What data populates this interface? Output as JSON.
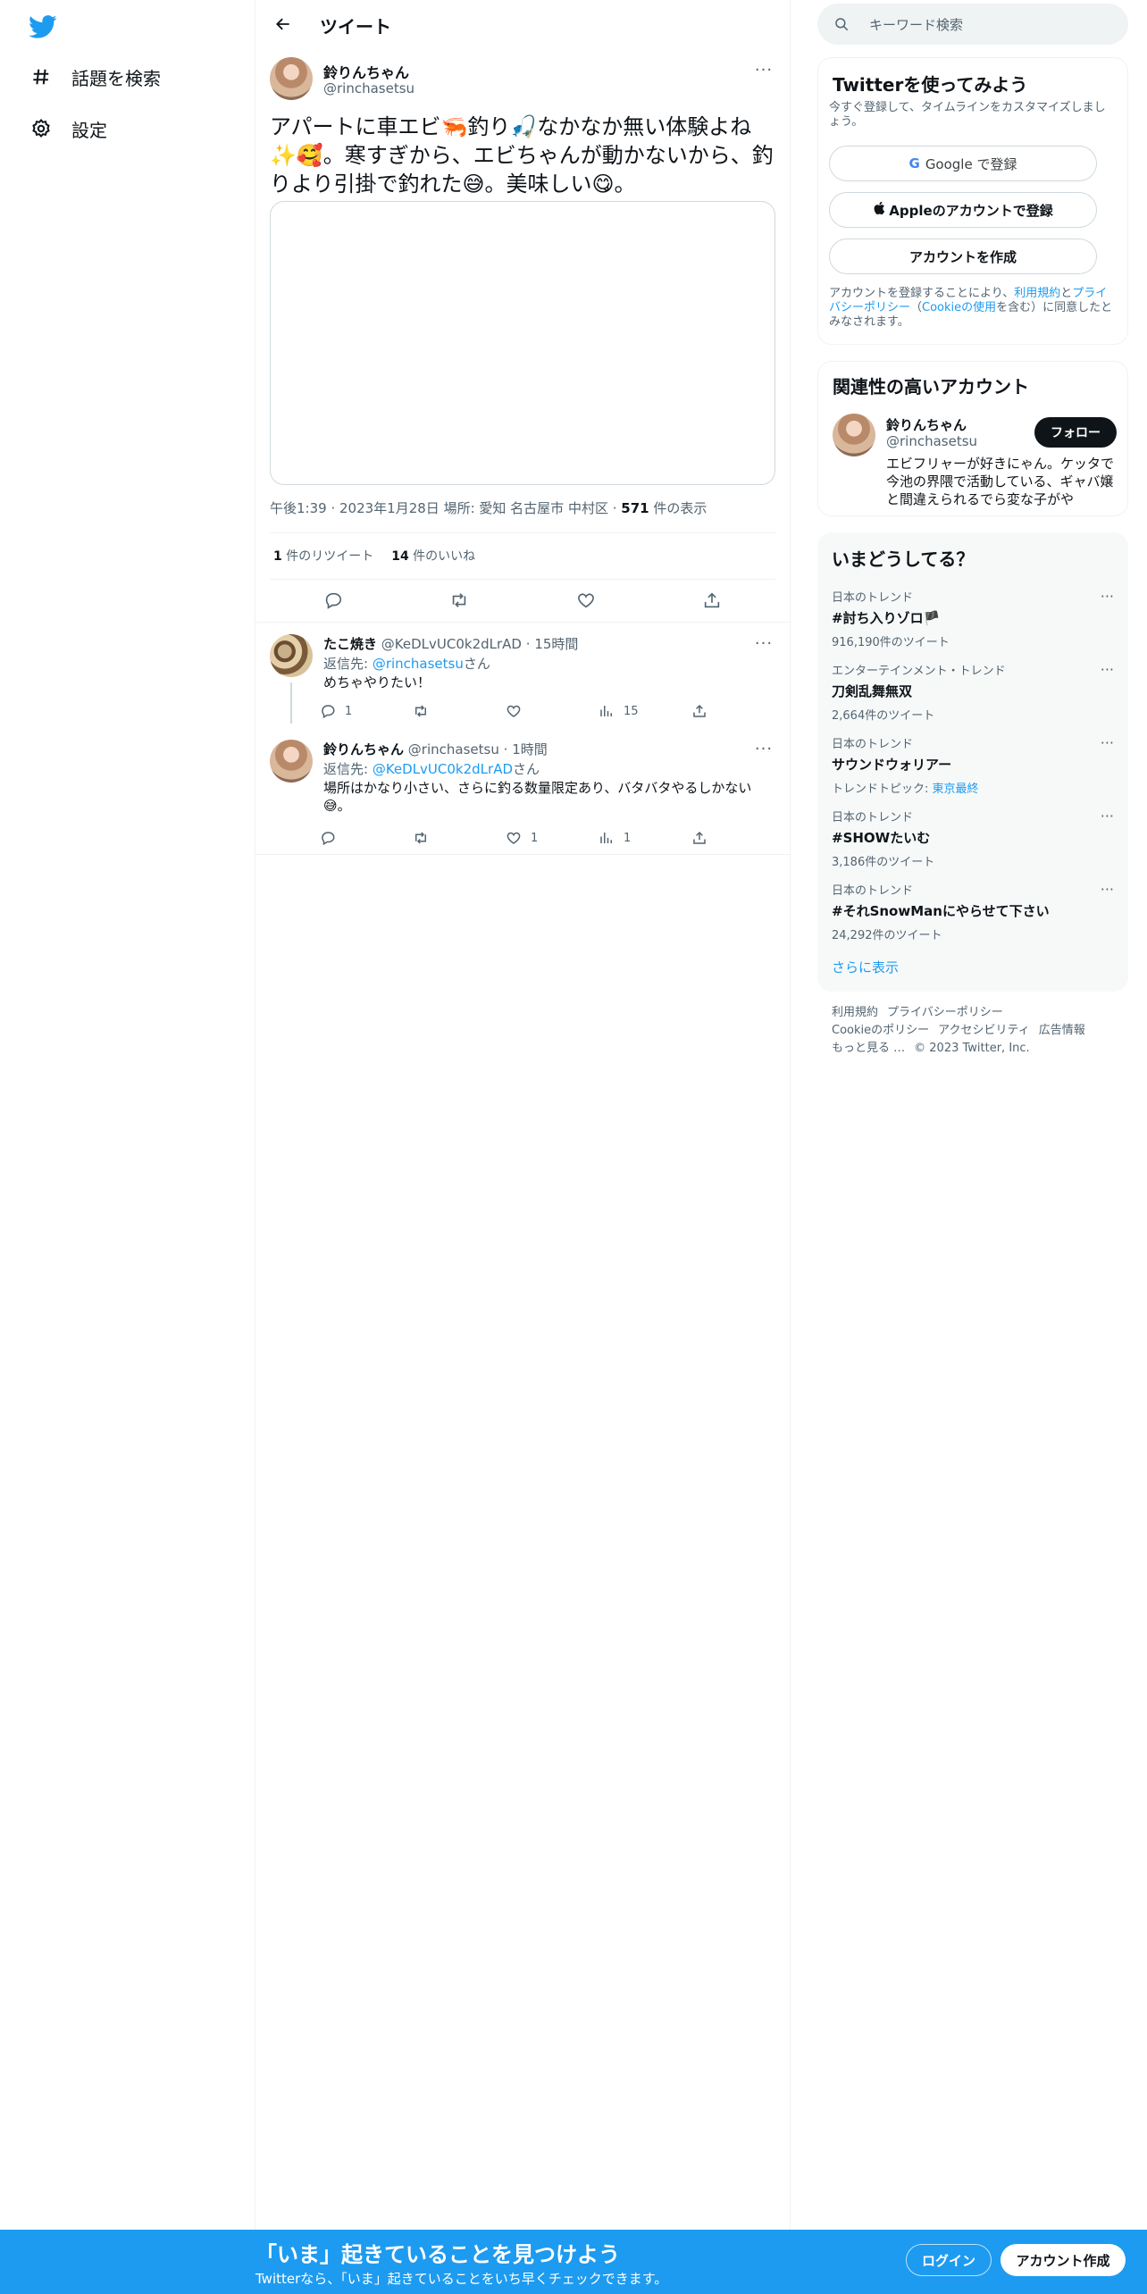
{
  "nav": {
    "items": [
      {
        "label": "話題を検索",
        "icon": "hashtag-icon"
      },
      {
        "label": "設定",
        "icon": "gear-icon"
      }
    ]
  },
  "header": {
    "title": "ツイート"
  },
  "tweet": {
    "name": "鈴りんちゃん",
    "handle": "@rinchasetsu",
    "text": "アパートに車エビ🦐釣り🎣なかなか無い体験よね✨🥰。寒すぎから、エビちゃんが動かないから、釣りより引掛で釣れた😅。美味しい😋。",
    "time": "午後1:39",
    "date": "2023年1月28日",
    "location": "場所: 愛知 名古屋市 中村区",
    "views_count": "571",
    "views_label": "件の表示",
    "retweets_count": "1",
    "retweets_label": "件のリツイート",
    "likes_count": "14",
    "likes_label": "件のいいね"
  },
  "replies": [
    {
      "name": "たこ焼き",
      "handle": "@KeDLvUC0k2dLrAD",
      "time": "15時間",
      "to_prefix": "返信先: ",
      "to": "@rinchasetsu",
      "to_suffix": "さん",
      "text": "めちゃやりたい！",
      "reply_count": "1",
      "retweet_count": "",
      "like_count": "",
      "views": "15"
    },
    {
      "name": "鈴りんちゃん",
      "handle": "@rinchasetsu",
      "time": "1時間",
      "to_prefix": "返信先: ",
      "to": "@KeDLvUC0k2dLrAD",
      "to_suffix": "さん",
      "text": "場所はかなり小さい、さらに釣る数量限定あり、バタバタやるしかない😅。",
      "reply_count": "",
      "retweet_count": "",
      "like_count": "1",
      "views": "1"
    }
  ],
  "search": {
    "placeholder": "キーワード検索"
  },
  "signup": {
    "title": "Twitterを使ってみよう",
    "subtitle": "今すぐ登録して、タイムラインをカスタマイズしましょう。",
    "google": "Google で登録",
    "apple": "Appleのアカウントで登録",
    "create": "アカウントを作成",
    "legal_1": "アカウントを登録することにより、",
    "legal_terms": "利用規約",
    "legal_2": "と",
    "legal_privacy": "プライバシーポリシー",
    "legal_3": "（",
    "legal_cookie": "Cookieの使用",
    "legal_4": "を含む）に同意したとみなされます。"
  },
  "related": {
    "title": "関連性の高いアカウント",
    "name": "鈴りんちゃん",
    "handle": "@rinchasetsu",
    "follow": "フォロー",
    "bio": "エビフリャーが好きにゃん。ケッタで今池の界隈で活動している、ギャバ嬢と間違えられるでら変な子がや"
  },
  "trends": {
    "title": "いまどうしてる？",
    "items": [
      {
        "context": "日本のトレンド",
        "name": "#討ち入りゾロ🏴",
        "count": "916,190件のツイート"
      },
      {
        "context": "エンターテインメント・トレンド",
        "name": "刀剣乱舞無双",
        "count": "2,664件のツイート"
      },
      {
        "context": "日本のトレンド",
        "name": "サウンドウォリアー",
        "count": "トレンドトピック: ",
        "topic": "東京最終"
      },
      {
        "context": "日本のトレンド",
        "name": "#SHOWたいむ",
        "count": "3,186件のツイート"
      },
      {
        "context": "日本のトレンド",
        "name": "#それSnowManにやらせて下さい",
        "count": "24,292件のツイート"
      }
    ],
    "show_more": "さらに表示"
  },
  "footer": {
    "links": [
      "利用規約",
      "プライバシーポリシー",
      "Cookieのポリシー",
      "アクセシビリティ",
      "広告情報",
      "もっと見る …",
      "© 2023 Twitter, Inc."
    ]
  },
  "bottom": {
    "title": "「いま」起きていることを見つけよう",
    "subtitle": "Twitterなら、「いま」起きていることをいち早くチェックできます。",
    "login": "ログイン",
    "signup": "アカウント作成"
  },
  "colors": {
    "accent": "#1d9bf0",
    "text": "#0f1419",
    "muted": "#536471"
  }
}
